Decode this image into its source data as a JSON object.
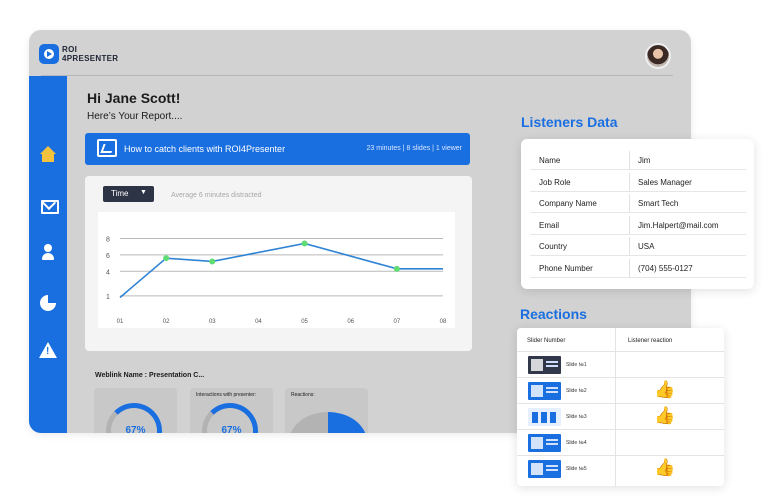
{
  "app": {
    "logo_line1": "ROI",
    "logo_line2": "4PRESENTER",
    "greeting": "Hi Jane Scott!",
    "subgreeting": "Here’s Your Report....",
    "banner": {
      "title": "How to catch clients with ROI4Presenter",
      "meta": "23 minutes | 8 slides | 1 viewer"
    },
    "time_button": "Time",
    "caret": "▼",
    "distracted": "Average 6 minutes distracted",
    "weblink": "Weblink Name : Presentation C...",
    "mini_cards": [
      {
        "title": "",
        "value": "67%"
      },
      {
        "title": "Interactions with presenter:",
        "value": "67%"
      },
      {
        "title": "Reactions:",
        "value": ""
      }
    ]
  },
  "chart_data": {
    "type": "line",
    "x": [
      "01",
      "02",
      "03",
      "04",
      "05",
      "06",
      "07",
      "08"
    ],
    "ytick_labels": [
      "8",
      "6",
      "4",
      "1"
    ],
    "series": [
      {
        "values": [
          0.8,
          5.6,
          5.2,
          null,
          7.4,
          null,
          4.3,
          4.3
        ]
      }
    ],
    "markers_at": [
      "02",
      "03",
      "05",
      "07"
    ],
    "line_color": "#2f83d4",
    "marker_color": "#5fdc73",
    "grid": true
  },
  "listeners": {
    "title": "Listeners Data",
    "rows": [
      {
        "key": "Name",
        "value": "Jim"
      },
      {
        "key": "Job Role",
        "value": "Sales Manager"
      },
      {
        "key": "Company Name",
        "value": "Smart Tech"
      },
      {
        "key": "Email",
        "value": "Jim.Halpert@mail.com"
      },
      {
        "key": "Country",
        "value": "USA"
      },
      {
        "key": "Phone Number",
        "value": "(704) 555-0127"
      }
    ]
  },
  "reactions": {
    "title": "Reactions",
    "col_slide": "Slider Number",
    "col_reaction": "Listener reaction",
    "rows": [
      {
        "slide": "Slide №1",
        "reaction": "",
        "thumb": "dark"
      },
      {
        "slide": "Slide №2",
        "reaction": "👍",
        "thumb": "blue"
      },
      {
        "slide": "Slide №3",
        "reaction": "👍",
        "thumb": "bars"
      },
      {
        "slide": "Slide №4",
        "reaction": "",
        "thumb": "blue"
      },
      {
        "slide": "Slide №5",
        "reaction": "👍",
        "thumb": "blue"
      }
    ]
  },
  "colors": {
    "brand": "#1a6fe0",
    "panel_bg": "#d2d2d2",
    "home_icon": "#f5c23d"
  },
  "icons": [
    "home-icon",
    "mail-icon",
    "user-icon",
    "pie-chart-icon",
    "warning-icon",
    "presentation-icon"
  ]
}
